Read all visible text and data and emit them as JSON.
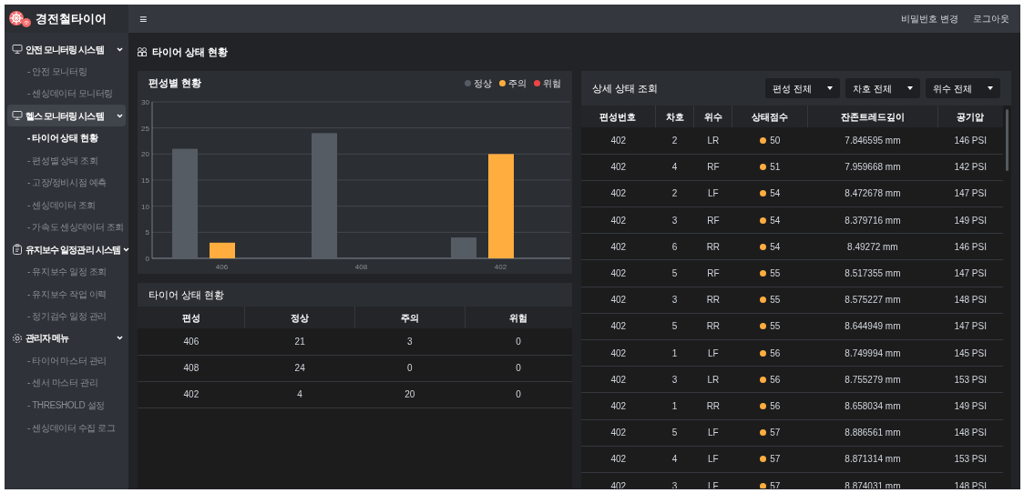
{
  "brand": {
    "name": "경전철타이어"
  },
  "topbar": {
    "menu_glyph": "≡",
    "links": [
      "비밀번호 변경",
      "로그아웃"
    ]
  },
  "sidebar": {
    "groups": [
      {
        "label": "안전 모니터링 시스템",
        "expanded": true,
        "selected": false,
        "items": [
          {
            "label": "- 안전 모니터링",
            "selected": false
          },
          {
            "label": "- 센싱데이터 모니터링",
            "selected": false
          }
        ]
      },
      {
        "label": "헬스 모니터링 시스템",
        "expanded": true,
        "selected": true,
        "items": [
          {
            "label": "- 타이어 상태 현황",
            "selected": true
          },
          {
            "label": "- 편성별 상태 조회",
            "selected": false
          },
          {
            "label": "- 고장/정비시점 예측",
            "selected": false
          },
          {
            "label": "- 센싱데이터 조회",
            "selected": false
          },
          {
            "label": "- 가속도 센싱데이터 조회",
            "selected": false
          }
        ]
      },
      {
        "label": "유지보수 일정관리 시스템",
        "expanded": true,
        "selected": false,
        "items": [
          {
            "label": "- 유지보수 일정 조회",
            "selected": false
          },
          {
            "label": "- 유지보수 작업 이력",
            "selected": false
          },
          {
            "label": "- 정기검수 일정 관리",
            "selected": false
          }
        ]
      },
      {
        "label": "관리자 메뉴",
        "expanded": true,
        "selected": false,
        "items": [
          {
            "label": "- 타이어 마스터 관리",
            "selected": false
          },
          {
            "label": "- 센서 마스터 관리",
            "selected": false
          },
          {
            "label": "- THRESHOLD 설정",
            "selected": false
          },
          {
            "label": "- 센싱데이터 수집 로그",
            "selected": false
          }
        ]
      }
    ]
  },
  "page_title": "타이어 상태 현황",
  "chart_panel": {
    "title": "편성별 현황",
    "chart_data": {
      "type": "bar",
      "categories": [
        "406",
        "408",
        "402"
      ],
      "series": [
        {
          "name": "정상",
          "color": "#565c64",
          "values": [
            21,
            24,
            4
          ]
        },
        {
          "name": "주의",
          "color": "#ffad3f",
          "values": [
            3,
            0,
            20
          ]
        },
        {
          "name": "위험",
          "color": "#ef4444",
          "values": [
            0,
            0,
            0
          ]
        }
      ],
      "ylim": [
        0,
        30
      ],
      "yticks": [
        0,
        5,
        10,
        15,
        20,
        25,
        30
      ],
      "grid": true
    }
  },
  "summary_table": {
    "title": "타이어 상태 현황",
    "columns": [
      "편성",
      "정상",
      "주의",
      "위험"
    ],
    "rows": [
      [
        "406",
        "21",
        "3",
        "0"
      ],
      [
        "408",
        "24",
        "0",
        "0"
      ],
      [
        "402",
        "4",
        "20",
        "0"
      ]
    ]
  },
  "detail_panel": {
    "title": "상세 상태 조회",
    "filters": [
      "편성 전체",
      "차호 전체",
      "위수 전체"
    ],
    "columns": [
      "편성번호",
      "차호",
      "위수",
      "상태점수",
      "잔존트레드깊이",
      "공기압"
    ],
    "rows": [
      {
        "train": "402",
        "car": "2",
        "pos": "LR",
        "score": "50",
        "color": "#ffad3f",
        "tread": "7.846595 mm",
        "pressure": "146 PSI"
      },
      {
        "train": "402",
        "car": "4",
        "pos": "RF",
        "score": "51",
        "color": "#ffad3f",
        "tread": "7.959668 mm",
        "pressure": "142 PSI"
      },
      {
        "train": "402",
        "car": "2",
        "pos": "LF",
        "score": "54",
        "color": "#ffad3f",
        "tread": "8.472678 mm",
        "pressure": "147 PSI"
      },
      {
        "train": "402",
        "car": "3",
        "pos": "RF",
        "score": "54",
        "color": "#ffad3f",
        "tread": "8.379716 mm",
        "pressure": "149 PSI"
      },
      {
        "train": "402",
        "car": "6",
        "pos": "RR",
        "score": "54",
        "color": "#ffad3f",
        "tread": "8.49272 mm",
        "pressure": "146 PSI"
      },
      {
        "train": "402",
        "car": "5",
        "pos": "RF",
        "score": "55",
        "color": "#ffad3f",
        "tread": "8.517355 mm",
        "pressure": "147 PSI"
      },
      {
        "train": "402",
        "car": "3",
        "pos": "RR",
        "score": "55",
        "color": "#ffad3f",
        "tread": "8.575227 mm",
        "pressure": "148 PSI"
      },
      {
        "train": "402",
        "car": "5",
        "pos": "RR",
        "score": "55",
        "color": "#ffad3f",
        "tread": "8.644949 mm",
        "pressure": "147 PSI"
      },
      {
        "train": "402",
        "car": "1",
        "pos": "LF",
        "score": "56",
        "color": "#ffad3f",
        "tread": "8.749994 mm",
        "pressure": "145 PSI"
      },
      {
        "train": "402",
        "car": "3",
        "pos": "LR",
        "score": "56",
        "color": "#ffad3f",
        "tread": "8.755279 mm",
        "pressure": "153 PSI"
      },
      {
        "train": "402",
        "car": "1",
        "pos": "RR",
        "score": "56",
        "color": "#ffad3f",
        "tread": "8.658034 mm",
        "pressure": "149 PSI"
      },
      {
        "train": "402",
        "car": "5",
        "pos": "LF",
        "score": "57",
        "color": "#ffad3f",
        "tread": "8.886561 mm",
        "pressure": "148 PSI"
      },
      {
        "train": "402",
        "car": "4",
        "pos": "LF",
        "score": "57",
        "color": "#ffad3f",
        "tread": "8.871314 mm",
        "pressure": "153 PSI"
      },
      {
        "train": "402",
        "car": "3",
        "pos": "LF",
        "score": "57",
        "color": "#ffad3f",
        "tread": "8.874031 mm",
        "pressure": "148 PSI"
      }
    ]
  }
}
